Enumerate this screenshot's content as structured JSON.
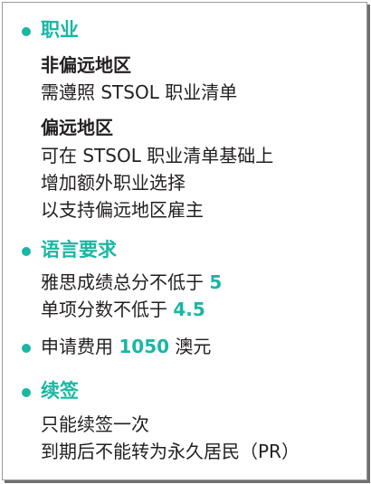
{
  "colors": {
    "accent": "#1ab7a3",
    "text": "#231f20",
    "border": "#9a9a9a"
  },
  "sections": [
    {
      "title": "职业",
      "groups": [
        {
          "subtitle": "非偏远地区",
          "lines": [
            "需遵照 STSOL 职业清单"
          ]
        },
        {
          "subtitle": "偏远地区",
          "lines": [
            "可在 STSOL 职业清单基础上",
            "增加额外职业选择",
            "以支持偏远地区雇主"
          ]
        }
      ]
    },
    {
      "title": "语言要求",
      "lines": [
        {
          "text": "雅思成绩总分不低于 ",
          "value": "5"
        },
        {
          "text": "单项分数不低于 ",
          "value": "4.5"
        }
      ]
    },
    {
      "line": {
        "text": "申请费用 ",
        "value": "1050",
        "suffix": " 澳元"
      }
    },
    {
      "title": "续签",
      "lines": [
        "只能续签一次",
        "到期后不能转为永久居民（PR）"
      ]
    }
  ]
}
